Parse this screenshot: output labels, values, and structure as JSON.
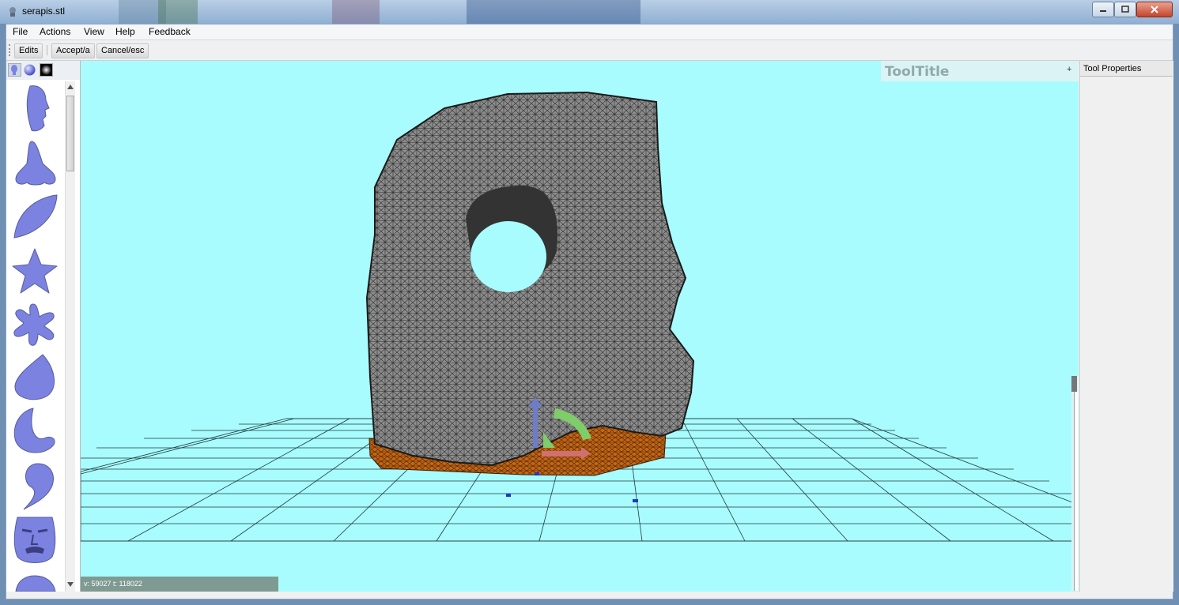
{
  "window": {
    "title": "serapis.stl"
  },
  "menu": [
    "File",
    "Actions",
    "View",
    "Help",
    "Feedback"
  ],
  "toolbar": {
    "edits": "Edits",
    "accept": "Accept/a",
    "cancel": "Cancel/esc"
  },
  "palette": {
    "tabs": [
      "head-tab-icon",
      "sphere-tab-icon",
      "black-square-tab-icon"
    ],
    "shapes": [
      "face-profile",
      "nose",
      "leaf",
      "star",
      "splat",
      "blob",
      "blob-curved",
      "comma",
      "mask",
      "half-sphere"
    ],
    "color": "#7b82e0"
  },
  "viewport": {
    "background": "#a8fcfe",
    "tool_title": "ToolTitle",
    "tool_title_toggle": "+",
    "status": "v: 59027  t: 118022"
  },
  "properties": {
    "title": "Tool Properties"
  }
}
